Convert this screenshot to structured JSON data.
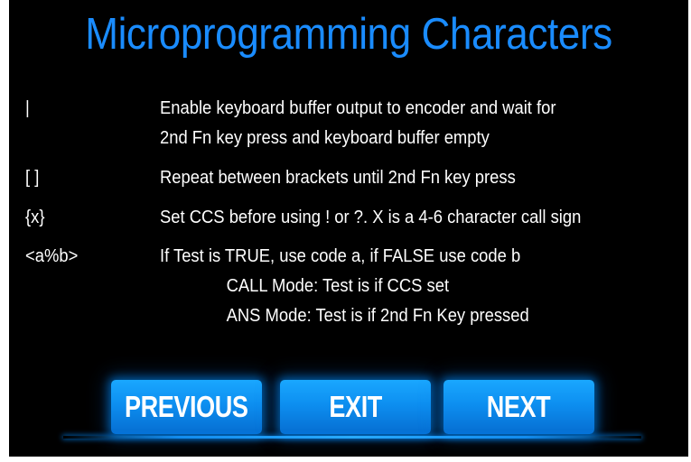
{
  "colors": {
    "background": "#000000",
    "title": "#1a8cff",
    "text": "#ffffff",
    "button": "#0d8ff0",
    "button_glow": "#1aa7ff"
  },
  "header": {
    "title": "Microprogramming Characters"
  },
  "rows": [
    {
      "symbol": "|",
      "lines": [
        "Enable keyboard buffer output to encoder and wait for",
        "2nd Fn key press and keyboard buffer empty"
      ]
    },
    {
      "symbol": "[ ]",
      "lines": [
        "Repeat between brackets until 2nd Fn key press"
      ]
    },
    {
      "symbol": "{x}",
      "lines": [
        "Set CCS before using ! or ?.  X is a 4-6 character call sign"
      ]
    },
    {
      "symbol": "<a%b>",
      "lines": [
        "If Test is TRUE, use code a, if FALSE use code b"
      ],
      "sublines": [
        "CALL Mode: Test is if CCS set",
        "ANS Mode: Test is if 2nd Fn Key pressed"
      ]
    }
  ],
  "buttons": {
    "previous": "PREVIOUS",
    "exit": "EXIT",
    "next": "NEXT"
  }
}
